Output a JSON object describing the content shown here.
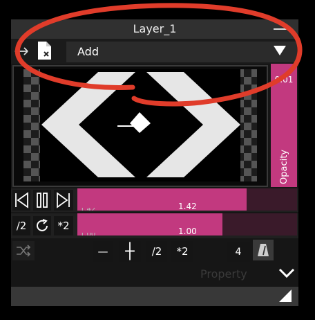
{
  "layer": {
    "title": "Layer_1",
    "blend_mode": "Add",
    "opacity_value": "0.01",
    "opacity_label": "Opacity",
    "opacity_level": 1.0
  },
  "playback": {
    "speed_value": "1.42",
    "speed_sub": "1.42",
    "speed_fraction": 0.77,
    "scale_value": "1.00",
    "scale_sub": "1.00",
    "scale_fraction": 0.66,
    "half_label": "/2",
    "double_label": "*2"
  },
  "tools": {
    "minus": "—",
    "plus": "┼",
    "half_label": "/2",
    "double_label": "*2",
    "count": "4"
  },
  "footer": {
    "property_label": "Property"
  },
  "colors": {
    "accent": "#c2397f",
    "annotation": "#e03c2a"
  },
  "icons": [
    "move-horizontal-icon",
    "file-delete-icon",
    "dropdown-arrow-icon",
    "skip-back-icon",
    "pause-icon",
    "skip-forward-icon",
    "refresh-icon",
    "shuffle-icon",
    "metronome-icon",
    "chevron-down-icon",
    "resize-corner-icon"
  ]
}
